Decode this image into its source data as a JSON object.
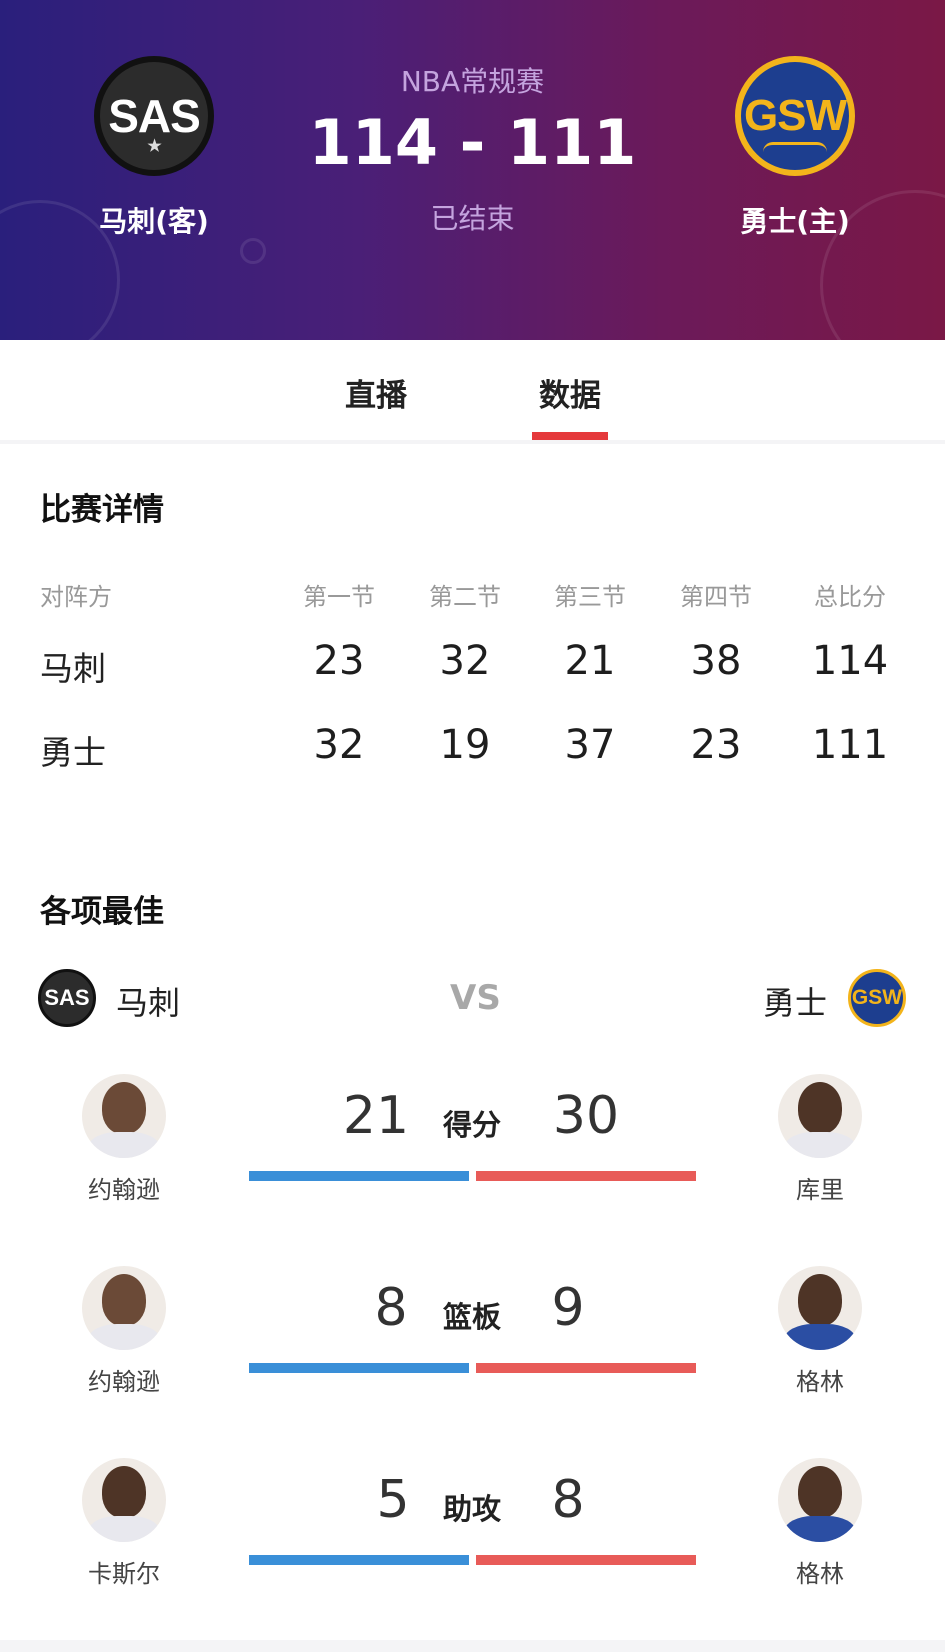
{
  "header": {
    "league": "NBA常规赛",
    "score": "114 - 111",
    "status": "已结束",
    "away_team": {
      "abbr": "SAS",
      "name": "马刺(客)"
    },
    "home_team": {
      "abbr": "GSW",
      "name": "勇士(主)"
    },
    "colors": {
      "away_primary": "#2c2c2c",
      "home_primary": "#1d3e8f",
      "home_accent": "#f3b41b"
    }
  },
  "tabs": [
    {
      "label": "直播",
      "active": false
    },
    {
      "label": "数据",
      "active": true
    }
  ],
  "match_details": {
    "title": "比赛详情",
    "columns": [
      "对阵方",
      "第一节",
      "第二节",
      "第三节",
      "第四节",
      "总比分"
    ],
    "rows": [
      {
        "team": "马刺",
        "scores": [
          "23",
          "32",
          "21",
          "38",
          "114"
        ]
      },
      {
        "team": "勇士",
        "scores": [
          "32",
          "19",
          "37",
          "23",
          "111"
        ]
      }
    ]
  },
  "leaders": {
    "title": "各项最佳",
    "away_team": "马刺",
    "home_team": "勇士",
    "away_logo": "SAS",
    "home_logo": "GSW",
    "vs": "VS",
    "stats": [
      {
        "label": "得分",
        "away_value": "21",
        "home_value": "30",
        "away_player": "约翰逊",
        "home_player": "库里"
      },
      {
        "label": "篮板",
        "away_value": "8",
        "home_value": "9",
        "away_player": "约翰逊",
        "home_player": "格林"
      },
      {
        "label": "助攻",
        "away_value": "5",
        "home_value": "8",
        "away_player": "卡斯尔",
        "home_player": "格林"
      }
    ]
  },
  "icons": [
    "sas-team-logo",
    "gsw-team-logo",
    "player-avatar"
  ],
  "accent_colors": {
    "tab_underline": "#e5393b",
    "away_bar": "#3a8fd8",
    "home_bar": "#e85b58"
  }
}
